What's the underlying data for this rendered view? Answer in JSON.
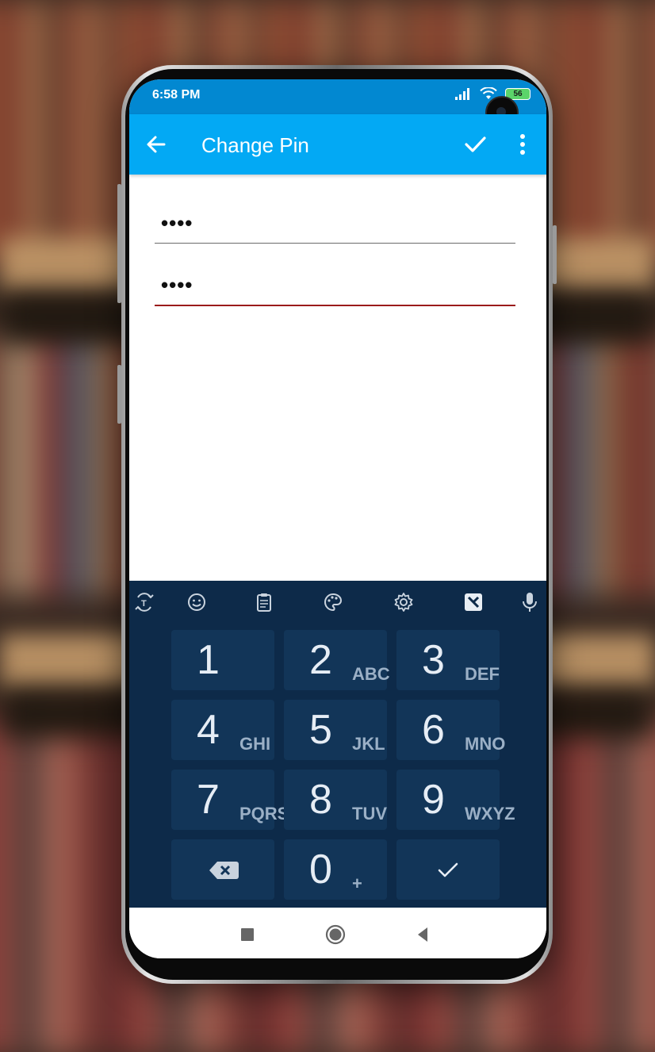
{
  "status": {
    "time": "6:58 PM",
    "battery": "56",
    "signal_icon": "signal-icon",
    "wifi_icon": "wifi-icon"
  },
  "appbar": {
    "title": "Change Pin",
    "back_icon": "arrow-left-icon",
    "confirm_icon": "check-icon",
    "menu_icon": "more-vertical-icon"
  },
  "form": {
    "pin_current": "••••",
    "pin_new": "••••"
  },
  "keyboard": {
    "toolbar": [
      "translate-icon",
      "emoji-icon",
      "clipboard-icon",
      "palette-icon",
      "gear-icon",
      "news-icon",
      "mic-icon"
    ],
    "keys": [
      {
        "num": "1",
        "letters": ""
      },
      {
        "num": "2",
        "letters": "ABC"
      },
      {
        "num": "3",
        "letters": "DEF"
      },
      {
        "num": "4",
        "letters": "GHI"
      },
      {
        "num": "5",
        "letters": "JKL"
      },
      {
        "num": "6",
        "letters": "MNO"
      },
      {
        "num": "7",
        "letters": "PQRS"
      },
      {
        "num": "8",
        "letters": "TUV"
      },
      {
        "num": "9",
        "letters": "WXYZ"
      },
      {
        "num": "",
        "letters": "",
        "icon": "backspace-icon"
      },
      {
        "num": "0",
        "letters": "+"
      },
      {
        "num": "",
        "letters": "",
        "icon": "check-icon"
      }
    ]
  },
  "nav": [
    "square-icon",
    "circle-icon",
    "triangle-back-icon"
  ],
  "colors": {
    "statusbar": "#0288d1",
    "appbar": "#03a9f4",
    "keyboard": "#0d2a49",
    "key": "#123558",
    "accent_underline": "#9b1b1b"
  }
}
